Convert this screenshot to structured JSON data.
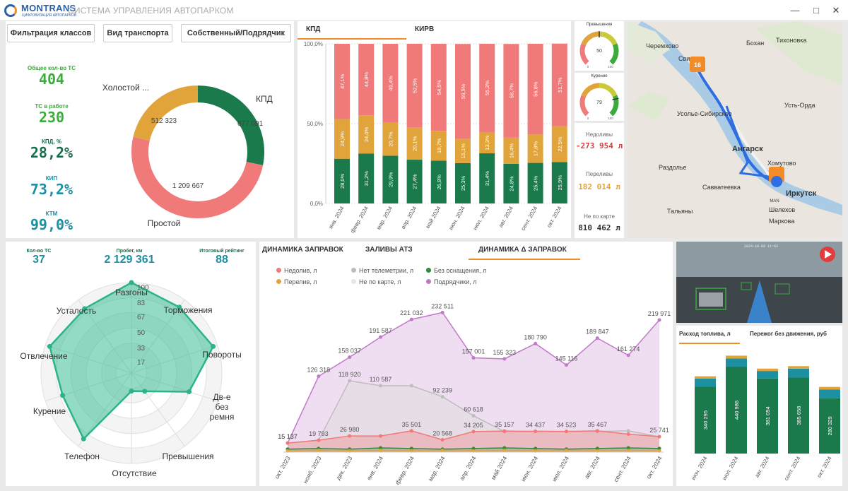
{
  "app": {
    "logo": "MONTRANS",
    "logo_sub": "ЦИФРОВИЗАЦИЯ АВТОПАРКОВ",
    "title": "СИСТЕМА УПРАВЛЕНИЯ АВТОПАРКОМ",
    "window_controls": [
      "minimize-icon",
      "maximize-icon",
      "close-icon"
    ]
  },
  "filters": [
    "Фильтрация классов",
    "Вид транспорта",
    "Собственный/Подрядчик"
  ],
  "kpis": [
    {
      "label": "Общее кол-во ТС",
      "value": "404",
      "color": "#3caa3c"
    },
    {
      "label": "ТС в работе",
      "value": "230",
      "color": "#3caa3c"
    },
    {
      "label": "КПД, %",
      "value": "28,2%",
      "color": "#1a6b4a"
    },
    {
      "label": "КИП",
      "value": "73,2%",
      "color": "#1c8fa0"
    },
    {
      "label": "КТМ",
      "value": "99,0%",
      "color": "#1c8fa0"
    }
  ],
  "donut": {
    "segments": [
      {
        "name": "КПД",
        "value": 677091,
        "label": "677 091",
        "color": "#1a7a4c"
      },
      {
        "name": "Простой",
        "value": 1209667,
        "label": "1 209 667",
        "color": "#f07a7a"
      },
      {
        "name": "Холостой ...",
        "value": 512323,
        "label": "512 323",
        "color": "#e0a43a"
      }
    ]
  },
  "bar_tabs": [
    "КПД",
    "КИРВ"
  ],
  "gauges": [
    {
      "title": "Превышения",
      "value": 50,
      "min": 0,
      "max": 100
    },
    {
      "title": "Курение",
      "value": 79,
      "min": 0,
      "max": 100
    }
  ],
  "side_stats": [
    {
      "label": "Недоливы",
      "value": "-273 954 л",
      "color": "#e03c3c"
    },
    {
      "label": "Переливы",
      "value": "182 014 л",
      "color": "#e0a43a"
    },
    {
      "label": "Не по карте",
      "value": "810 462 л",
      "color": "#333333"
    }
  ],
  "map": {
    "labels": [
      "Черемхово",
      "Бохан",
      "Тихоновка",
      "Свирск",
      "Усолье-Сибирское",
      "Усть-Орда",
      "Раздолье",
      "Ангарск",
      "Хомутово",
      "Савватеевка",
      "Иркутск",
      "Шелехов",
      "Тальяны",
      "Маркова"
    ],
    "markers": [
      "16",
      "MAN"
    ]
  },
  "radar_stats": [
    {
      "label": "Кол-во ТС",
      "value": "37"
    },
    {
      "label": "Пробег, км",
      "value": "2 129 361"
    },
    {
      "label": "Итоговый рейтинг",
      "value": "88"
    }
  ],
  "radar": {
    "axes": [
      "Разгоны",
      "Торможения",
      "Повороты",
      "Дв-е без ремня",
      "Превышения",
      "Отсутствие",
      "Телефон",
      "Курение",
      "Отвлечение",
      "Усталость"
    ],
    "values": [
      100,
      90,
      95,
      67,
      25,
      20,
      90,
      80,
      95,
      88
    ],
    "rings": [
      "100",
      "83",
      "67",
      "50",
      "33",
      "17"
    ]
  },
  "refuel_tabs": [
    "ДИНАМИКА ЗАПРАВОК",
    "ЗАЛИВЫ АТЗ",
    "ДИНАМИКА Δ ЗАПРАВОК"
  ],
  "refuel_legend": [
    {
      "name": "Недолив, л",
      "color": "#f07a7a"
    },
    {
      "name": "Нет телеметрии, л",
      "color": "#bdbdbd"
    },
    {
      "name": "Без оснащения, л",
      "color": "#2e8b3e"
    },
    {
      "name": "Перелив, л",
      "color": "#e0a43a"
    },
    {
      "name": "Не по карте, л",
      "color": "#e6e6e6"
    },
    {
      "name": "Подрядчики, л",
      "color": "#c07ac8"
    }
  ],
  "video": {
    "timestamp": "2024-10-08 11:03"
  },
  "fuel_tabs": [
    "Расход топлива, л",
    "Пережог без движения, руб"
  ],
  "chart_data": [
    {
      "type": "bar",
      "stacked": true,
      "categories": [
        "янв. 2024",
        "февр. 2024",
        "мар. 2024",
        "апр. 2024",
        "май 2024",
        "июн. 2024",
        "июл. 2024",
        "авг. 2024",
        "сент. 2024",
        "окт. 2024"
      ],
      "series": [
        {
          "values": [
            28.0,
            31.2,
            29.9,
            27.4,
            26.8,
            25.3,
            31.4,
            24.8,
            25.4,
            25.9
          ],
          "labels": [
            "28,0%",
            "31,2%",
            "29,9%",
            "27,4%",
            "26,8%",
            "25,3%",
            "31,4%",
            "24,8%",
            "25,4%",
            "25,9%"
          ],
          "color": "#1a7a4c"
        },
        {
          "values": [
            24.9,
            24.0,
            20.7,
            20.1,
            18.7,
            15.1,
            13.3,
            16.4,
            17.8,
            22.5
          ],
          "labels": [
            "24,9%",
            "24,0%",
            "20,7%",
            "20,1%",
            "18,7%",
            "15,1%",
            "13,3%",
            "16,4%",
            "17,8%",
            "22,5%"
          ],
          "color": "#e0a43a"
        },
        {
          "values": [
            47.1,
            44.8,
            49.4,
            52.5,
            54.5,
            59.5,
            55.3,
            58.7,
            56.8,
            51.7
          ],
          "labels": [
            "47,1%",
            "44,8%",
            "49,4%",
            "52,5%",
            "54,5%",
            "59,5%",
            "55,3%",
            "58,7%",
            "56,8%",
            "51,7%"
          ],
          "color": "#f07a7a"
        }
      ],
      "ytick_labels": [
        "0,0%",
        "50,0%",
        "100,0%"
      ],
      "ylim": [
        0,
        100
      ]
    },
    {
      "type": "area",
      "categories": [
        "окт. 2023",
        "нояб. 2023",
        "дек. 2023",
        "янв. 2024",
        "февр. 2024",
        "мар. 2024",
        "апр. 2024",
        "май 2024",
        "июн. 2024",
        "июл. 2024",
        "авг. 2024",
        "сент. 2024",
        "окт. 2024"
      ],
      "series": [
        {
          "name": "Подрядчики, л",
          "color": "#c07ac8",
          "values": [
            15137,
            126318,
            158037,
            191587,
            221032,
            232511,
            157001,
            155323,
            180790,
            145116,
            189847,
            161274,
            219971
          ],
          "labels": [
            "15 137",
            "126 318",
            "158 037",
            "191 587",
            "221 032",
            "232 511",
            "157 001",
            "155 323",
            "180 790",
            "145 116",
            "189 847",
            "161 274",
            "219 971"
          ]
        },
        {
          "name": "Нет телеметрии, л",
          "color": "#bdbdbd",
          "values": [
            15137,
            19793,
            118920,
            110587,
            110587,
            92239,
            60618,
            34205,
            35157,
            34437,
            34523,
            35467,
            25741
          ],
          "labels": [
            "",
            "",
            "118 920",
            "110 587",
            "",
            "92 239",
            "60 618",
            "",
            "",
            "",
            "",
            "",
            ""
          ]
        },
        {
          "name": "Недолив, л",
          "color": "#f07a7a",
          "values": [
            15137,
            19793,
            26980,
            26980,
            35501,
            20568,
            34205,
            35157,
            34437,
            34523,
            35467,
            30000,
            25741
          ],
          "labels": [
            "15 137",
            "19 793",
            "26 980",
            "",
            "35 501",
            "20 568",
            "34 205",
            "35 157",
            "34 437",
            "34 523",
            "35 467",
            "",
            "25 741"
          ]
        },
        {
          "name": "Без оснащения, л",
          "color": "#2e8b3e",
          "values": [
            5000,
            6000,
            5000,
            7000,
            6000,
            5000,
            6000,
            7000,
            6000,
            5000,
            6000,
            7000,
            6000
          ]
        },
        {
          "name": "Перелив, л",
          "color": "#e0a43a",
          "values": [
            2000,
            3000,
            2000,
            3000,
            2000,
            3000,
            2000,
            3000,
            2000,
            3000,
            2000,
            3000,
            2000
          ]
        },
        {
          "name": "Не по карте, л",
          "color": "#e6e6e6",
          "values": [
            1000,
            1000,
            1000,
            1000,
            1000,
            1000,
            1000,
            1000,
            1000,
            1000,
            1000,
            1000,
            1000
          ]
        }
      ]
    },
    {
      "type": "bar",
      "stacked": true,
      "categories": [
        "июн. 2024",
        "июл. 2024",
        "авг. 2024",
        "сент. 2024",
        "окт. 2024"
      ],
      "series": [
        {
          "values": [
            340295,
            440986,
            381094,
            385658,
            280329
          ],
          "labels": [
            "340 295",
            "440 986",
            "381 094",
            "385 658",
            "280 329"
          ],
          "color": "#1a7a4c"
        },
        {
          "values": [
            40000,
            42000,
            38000,
            45000,
            45000
          ],
          "color": "#1c8fa0"
        },
        {
          "values": [
            12000,
            14000,
            12000,
            13000,
            13000
          ],
          "color": "#e0a43a"
        }
      ]
    }
  ]
}
